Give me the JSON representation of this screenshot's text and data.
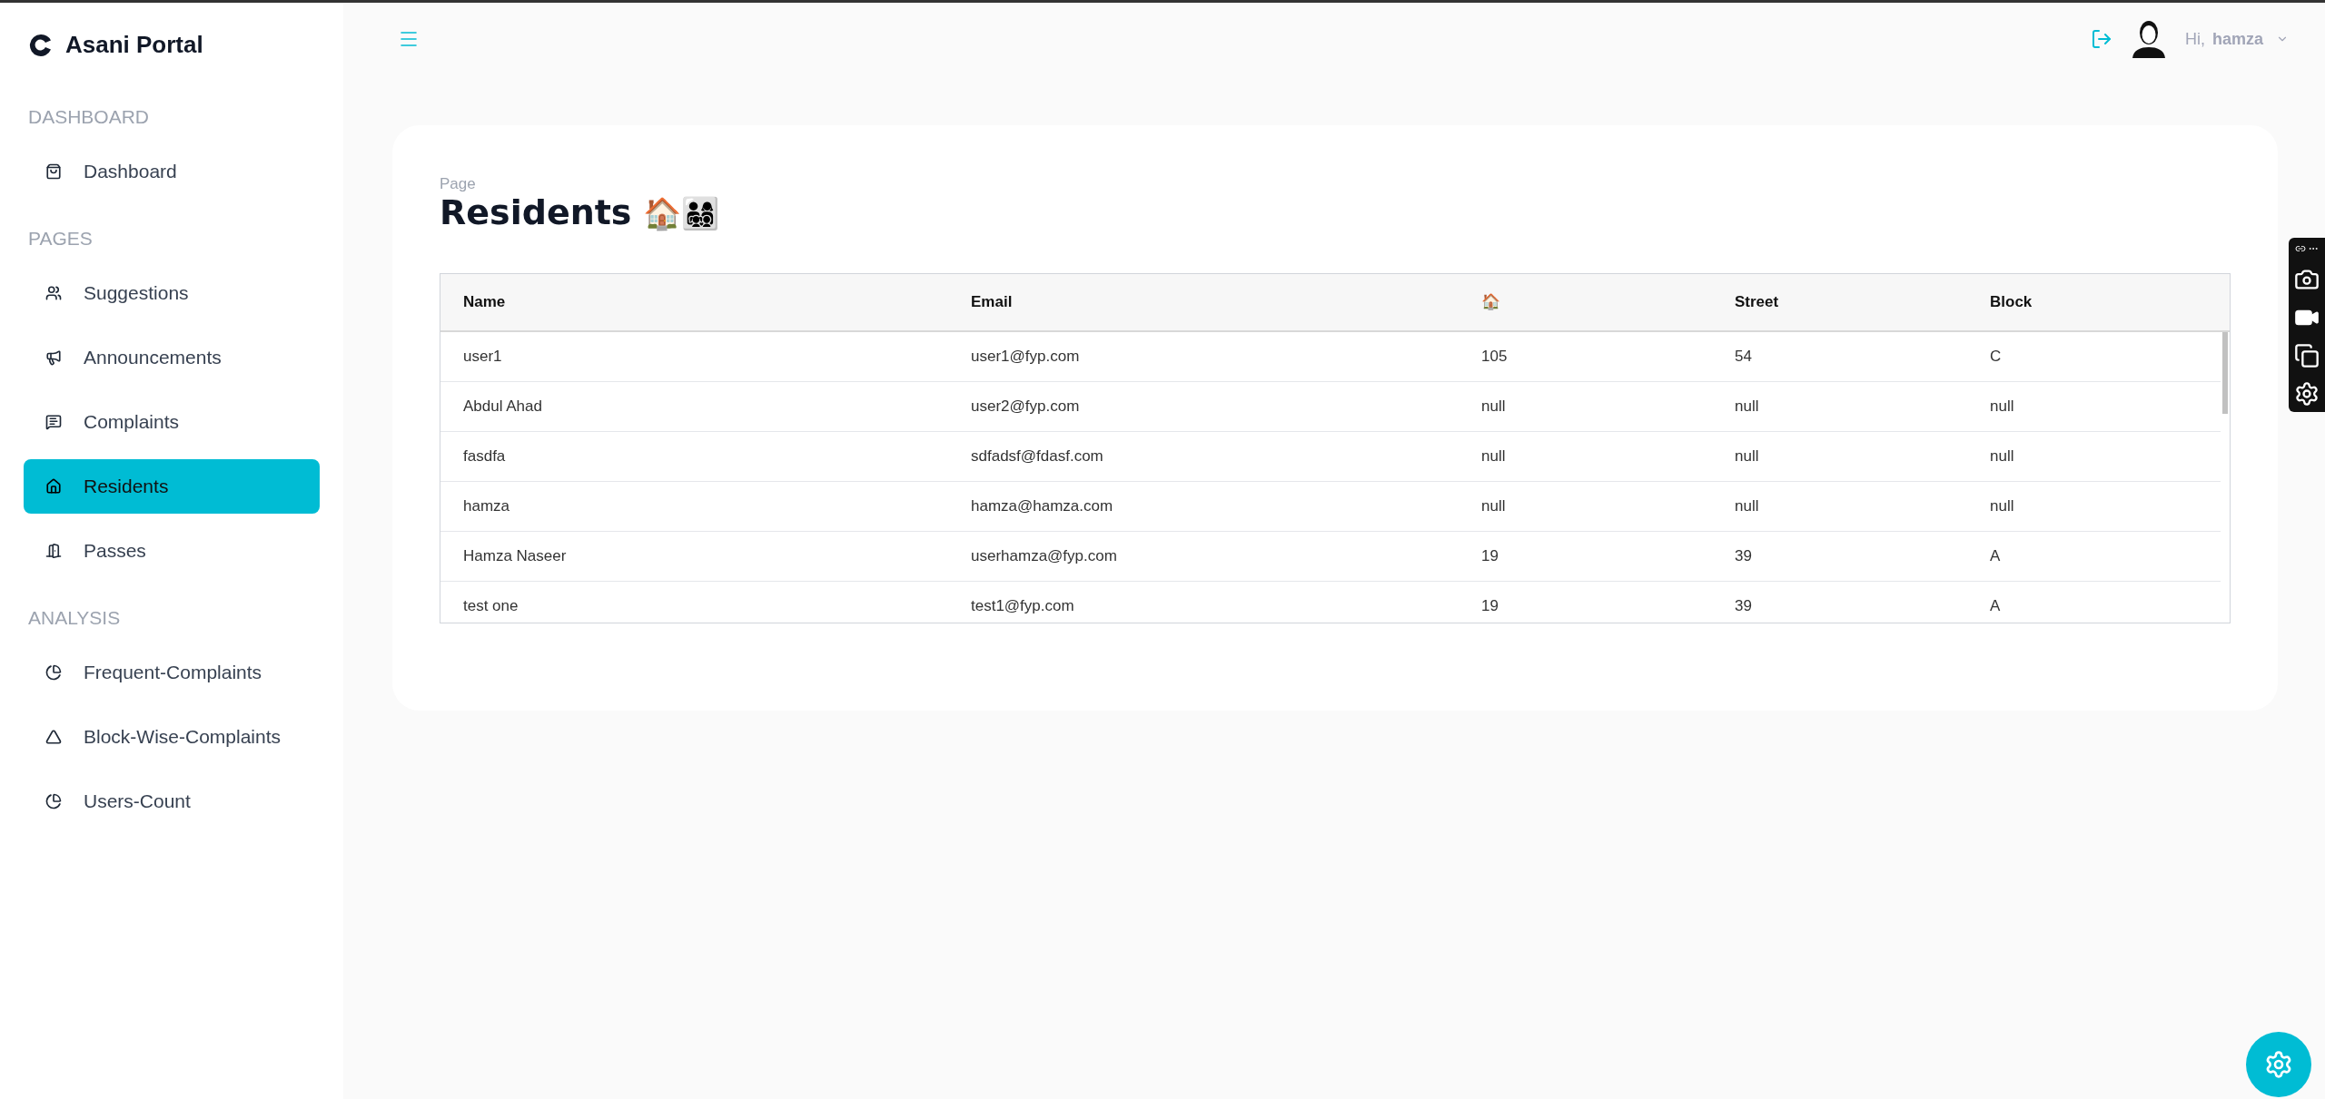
{
  "brand": "Asani Portal",
  "sidebar": {
    "sections": [
      {
        "heading": "DASHBOARD",
        "items": [
          {
            "label": "Dashboard",
            "selected": false
          }
        ]
      },
      {
        "heading": "PAGES",
        "items": [
          {
            "label": "Suggestions",
            "selected": false
          },
          {
            "label": "Announcements",
            "selected": false
          },
          {
            "label": "Complaints",
            "selected": false
          },
          {
            "label": "Residents",
            "selected": true
          },
          {
            "label": "Passes",
            "selected": false
          }
        ]
      },
      {
        "heading": "ANALYSIS",
        "items": [
          {
            "label": "Frequent-Complaints",
            "selected": false
          },
          {
            "label": "Block-Wise-Complaints",
            "selected": false
          },
          {
            "label": "Users-Count",
            "selected": false
          }
        ]
      }
    ]
  },
  "header": {
    "greeting": "Hi,",
    "username": "hamza"
  },
  "page": {
    "eyebrow": "Page",
    "title": "Residents",
    "title_emoji": "🏠👨‍👩‍👧‍👦"
  },
  "table": {
    "columns": [
      "Name",
      "Email",
      "🏠",
      "Street",
      "Block"
    ],
    "rows": [
      [
        "user1",
        "user1@fyp.com",
        "105",
        "54",
        "C"
      ],
      [
        "Abdul Ahad",
        "user2@fyp.com",
        "null",
        "null",
        "null"
      ],
      [
        "fasdfa",
        "sdfadsf@fdasf.com",
        "null",
        "null",
        "null"
      ],
      [
        "hamza",
        "hamza@hamza.com",
        "null",
        "null",
        "null"
      ],
      [
        "Hamza Naseer",
        "userhamza@fyp.com",
        "19",
        "39",
        "A"
      ],
      [
        "test one",
        "test1@fyp.com",
        "19",
        "39",
        "A"
      ]
    ]
  }
}
